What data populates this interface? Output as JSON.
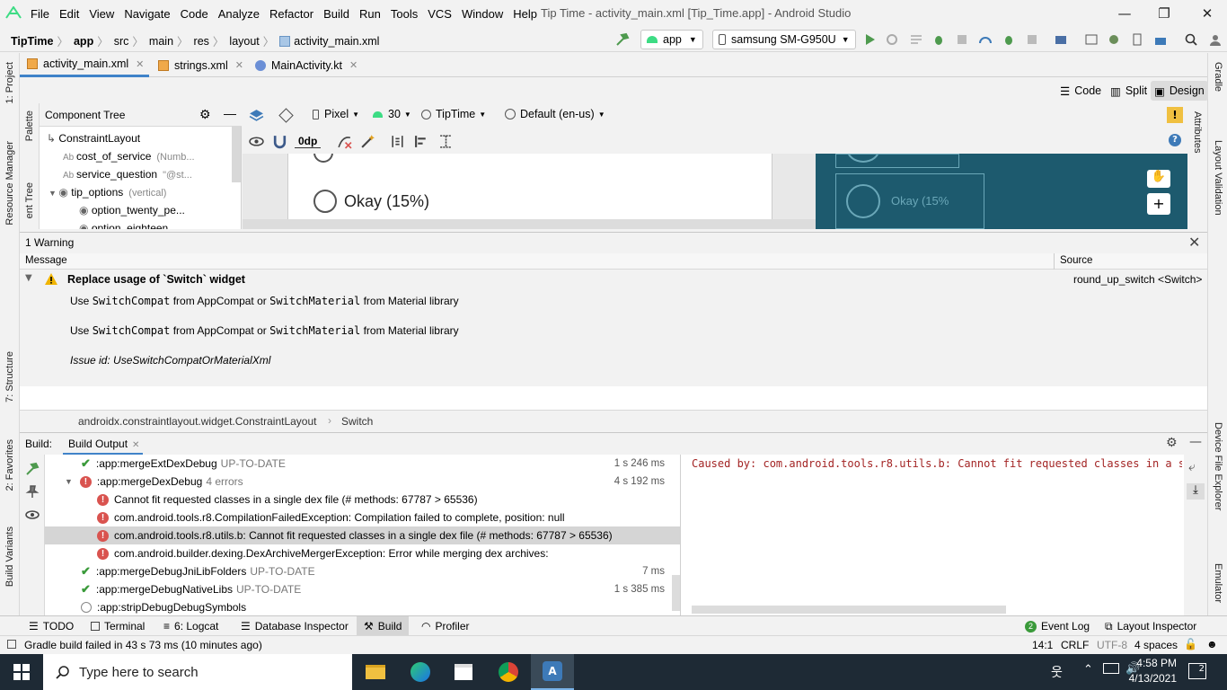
{
  "menu": [
    "File",
    "Edit",
    "View",
    "Navigate",
    "Code",
    "Analyze",
    "Refactor",
    "Build",
    "Run",
    "Tools",
    "VCS",
    "Window",
    "Help"
  ],
  "window_title": "Tip Time - activity_main.xml [Tip_Time.app] - Android Studio",
  "window_controls": {
    "minimize": "—",
    "maximize": "❐",
    "close": "✕"
  },
  "breadcrumb": [
    "TipTime",
    "app",
    "src",
    "main",
    "res",
    "layout",
    "activity_main.xml"
  ],
  "run_config": "app",
  "device": "samsung SM-G950U",
  "tabs": [
    {
      "label": "activity_main.xml",
      "active": true
    },
    {
      "label": "strings.xml",
      "active": false
    },
    {
      "label": "MainActivity.kt",
      "active": false
    }
  ],
  "left_strip": [
    "1: Project",
    "Resource Manager",
    "7: Structure",
    "2: Favorites",
    "Build Variants"
  ],
  "right_strip": [
    "Gradle",
    "Layout Validation",
    "Device File Explorer",
    "Emulator"
  ],
  "design_modes": {
    "code": "Code",
    "split": "Split",
    "design": "Design"
  },
  "palette_label": "Palette",
  "component_tree_side": "ent Tree",
  "attributes_label": "Attributes",
  "component_tree": {
    "title": "Component Tree",
    "items": [
      {
        "label": "ConstraintLayout",
        "hint": ""
      },
      {
        "label": "cost_of_service",
        "hint": "(Numb..."
      },
      {
        "label": "service_question",
        "hint": "\"@st..."
      },
      {
        "label": "tip_options",
        "hint": "(vertical)"
      },
      {
        "label": "option_twenty_pe...",
        "hint": ""
      },
      {
        "label": "option_eighteen...",
        "hint": ""
      }
    ]
  },
  "canvas_toolbar": {
    "device": "Pixel",
    "api": "30",
    "theme": "TipTime",
    "locale": "Default (en-us)",
    "margin": "0dp"
  },
  "canvas": {
    "radio_label": "Okay (15%)",
    "blueprint_label": "Okay (15%"
  },
  "problems": {
    "count_label": "1 Warning",
    "col_message": "Message",
    "col_source": "Source",
    "title": "Replace usage of `Switch` widget",
    "source": "round_up_switch <Switch>",
    "line1_pre": "Use ",
    "line1_code1": "SwitchCompat",
    "line1_mid": " from AppCompat or ",
    "line1_code2": "SwitchMaterial",
    "line1_post": " from Material library",
    "issue_id": "Issue id: UseSwitchCompatOrMaterialXml"
  },
  "element_path": [
    "androidx.constraintlayout.widget.ConstraintLayout",
    "Switch"
  ],
  "build": {
    "label": "Build:",
    "tab": "Build Output",
    "rows": [
      {
        "status": "ok",
        "text": ":app:mergeExtDexDebug",
        "note": "UP-TO-DATE",
        "time": "1 s 246 ms",
        "indent": 1
      },
      {
        "status": "err",
        "text": ":app:mergeDexDebug",
        "note": "4 errors",
        "time": "4 s 192 ms",
        "indent": 1
      },
      {
        "status": "err",
        "text": "Cannot fit requested classes in a single dex file (# methods: 67787 > 65536)",
        "note": "",
        "time": "",
        "indent": 2
      },
      {
        "status": "err",
        "text": "com.android.tools.r8.CompilationFailedException: Compilation failed to complete, position: null",
        "note": "",
        "time": "",
        "indent": 2
      },
      {
        "status": "err",
        "text": "com.android.tools.r8.utils.b: Cannot fit requested classes in a single dex file (# methods: 67787 > 65536)",
        "note": "",
        "time": "",
        "indent": 2,
        "selected": true
      },
      {
        "status": "err",
        "text": "com.android.builder.dexing.DexArchiveMergerException: Error while merging dex archives:",
        "note": "",
        "time": "",
        "indent": 2
      },
      {
        "status": "ok",
        "text": ":app:mergeDebugJniLibFolders",
        "note": "UP-TO-DATE",
        "time": "7 ms",
        "indent": 1
      },
      {
        "status": "ok",
        "text": ":app:mergeDebugNativeLibs",
        "note": "UP-TO-DATE",
        "time": "1 s 385 ms",
        "indent": 1
      },
      {
        "status": "skip",
        "text": ":app:stripDebugDebugSymbols",
        "note": "",
        "time": "",
        "indent": 1
      }
    ],
    "output": "Caused by: com.android.tools.r8.utils.b: Cannot fit requested classes in a sin"
  },
  "bottom_tools": [
    "TODO",
    "Terminal",
    "6: Logcat",
    "Database Inspector",
    "Build",
    "Profiler"
  ],
  "bottom_right": {
    "event_log": "Event Log",
    "event_count": "2",
    "layout_inspector": "Layout Inspector"
  },
  "status": {
    "message": "Gradle build failed in 43 s 73 ms (10 minutes ago)",
    "position": "14:1",
    "line_sep": "CRLF",
    "encoding": "UTF-8",
    "indent": "4 spaces"
  },
  "taskbar": {
    "search": "Type here to search",
    "time": "4:58 PM",
    "date": "4/13/2021",
    "notifications": "2"
  }
}
